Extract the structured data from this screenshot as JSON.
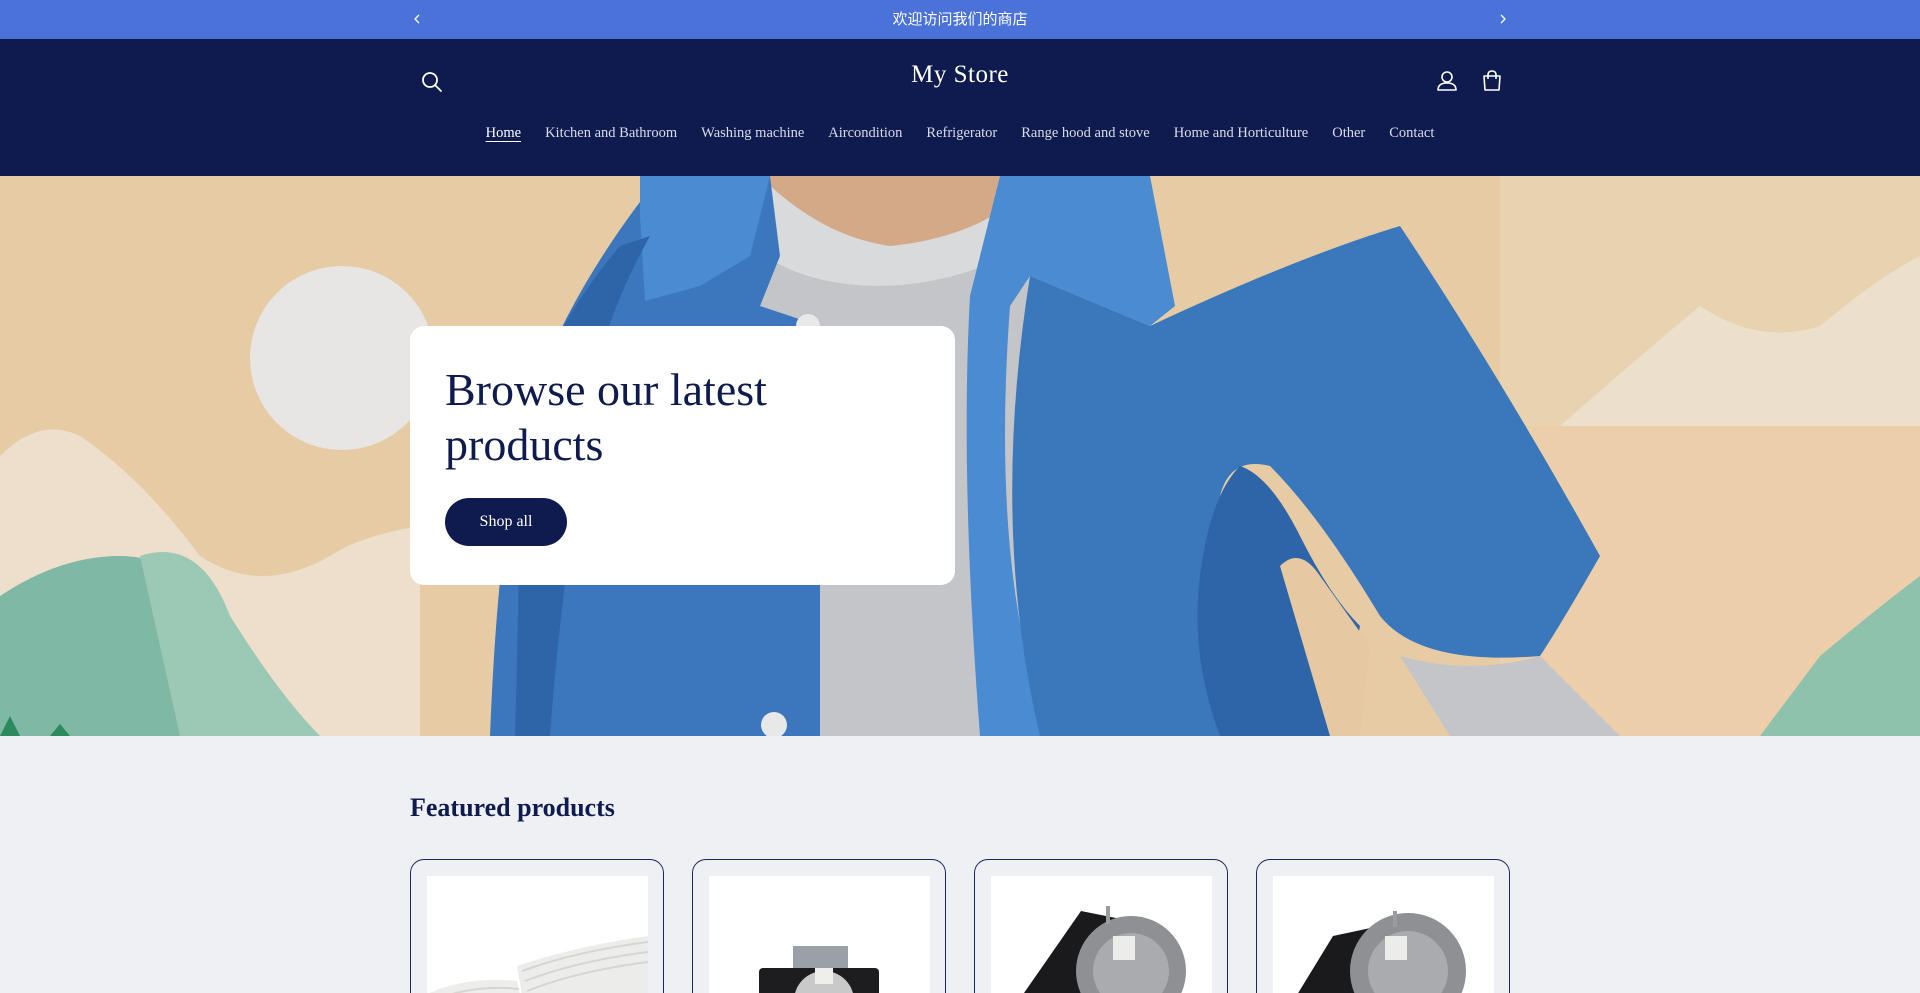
{
  "announcement": {
    "message": "欢迎访问我们的商店",
    "prev_icon": "chevron-left-icon",
    "next_icon": "chevron-right-icon"
  },
  "header": {
    "store_name": "My Store",
    "icons": [
      "search-icon",
      "account-icon",
      "cart-icon"
    ],
    "nav": [
      {
        "label": "Home",
        "active": true
      },
      {
        "label": "Kitchen and Bathroom"
      },
      {
        "label": "Washing machine"
      },
      {
        "label": "Aircondition"
      },
      {
        "label": "Refrigerator"
      },
      {
        "label": "Range hood and stove"
      },
      {
        "label": "Home and Horticulture"
      },
      {
        "label": "Other"
      },
      {
        "label": "Contact"
      }
    ]
  },
  "hero": {
    "heading": "Browse our latest products",
    "button_label": "Shop all"
  },
  "featured": {
    "title": "Featured products",
    "products": [
      {
        "image": "filter-pad-image"
      },
      {
        "image": "timer-switch-image"
      },
      {
        "image": "timer-motor-image"
      },
      {
        "image": "timer-motor-image"
      }
    ]
  },
  "colors": {
    "announcement_bg": "#4a72d8",
    "header_bg": "#0f1b4f",
    "page_bg": "#eef0f4",
    "accent": "#0f1b4f"
  }
}
